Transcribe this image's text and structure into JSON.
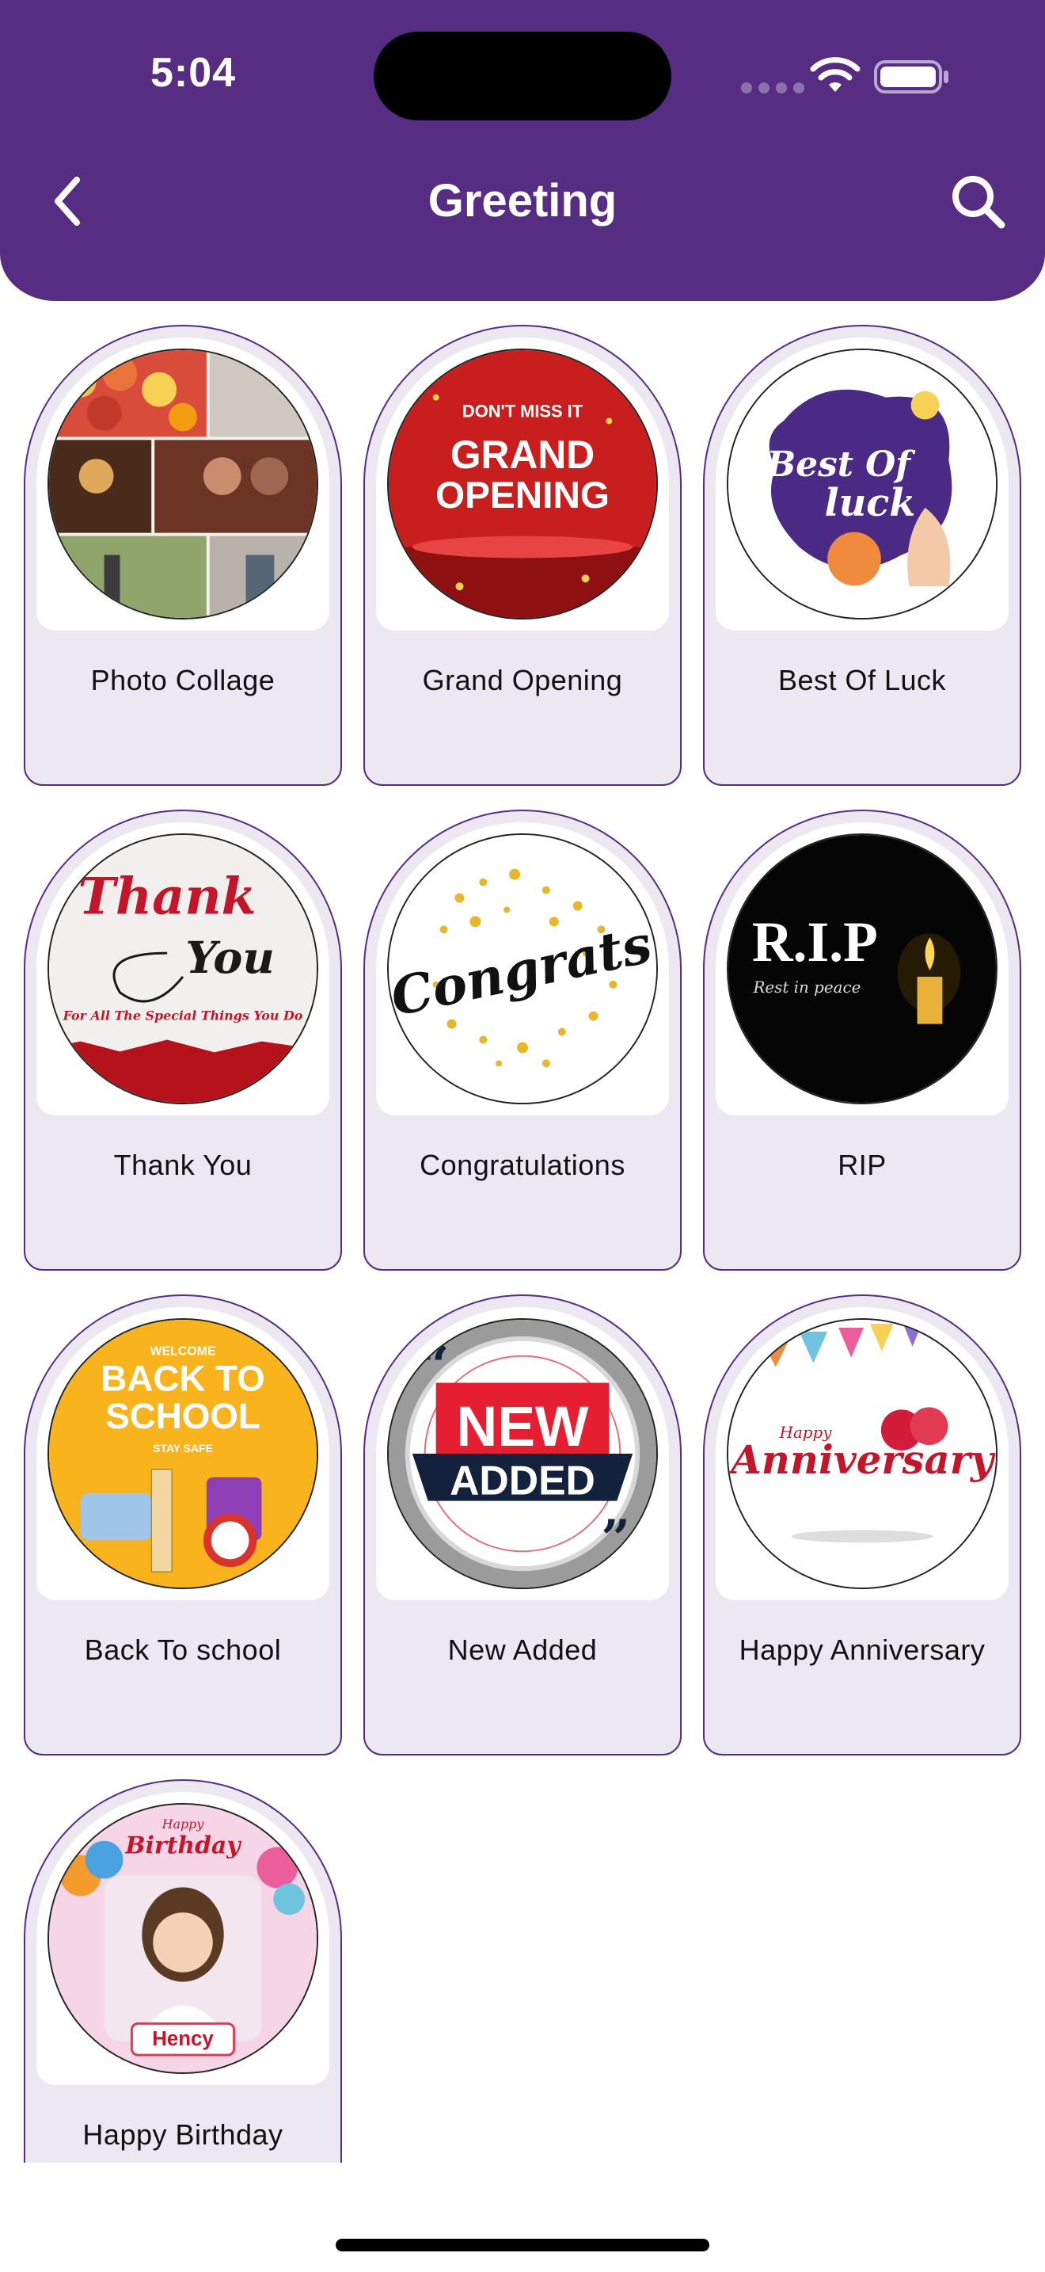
{
  "status_bar": {
    "time": "5:04"
  },
  "header": {
    "title": "Greeting"
  },
  "colors": {
    "header_bg": "#572c83",
    "card_bg": "#ebe8f2",
    "card_border": "#572c83"
  },
  "icons": {
    "back": "chevron-left-icon",
    "search": "search-icon",
    "wifi": "wifi-icon",
    "battery": "battery-icon"
  },
  "categories": [
    {
      "label": "Photo Collage"
    },
    {
      "label": "Grand Opening",
      "thumb_text": [
        "DON'T MISS IT",
        "GRAND",
        "OPENING"
      ]
    },
    {
      "label": "Best Of Luck",
      "thumb_text": [
        "Best Of",
        "luck"
      ]
    },
    {
      "label": "Thank You",
      "thumb_text": [
        "Thank",
        "You",
        "For All The Special Things You Do"
      ]
    },
    {
      "label": "Congratulations",
      "thumb_text": [
        "Congrats"
      ]
    },
    {
      "label": "RIP",
      "thumb_text": [
        "R.I.P",
        "Rest in peace"
      ]
    },
    {
      "label": "Back To school",
      "thumb_text": [
        "WELCOME",
        "BACK TO",
        "SCHOOL",
        "STAY SAFE"
      ]
    },
    {
      "label": "New Added",
      "thumb_text": [
        "NEW",
        "ADDED"
      ]
    },
    {
      "label": "Happy Anniversary",
      "thumb_text": [
        "Happy",
        "Anniversary"
      ]
    },
    {
      "label": "Happy Birthday",
      "thumb_text": [
        "Happy",
        "Birthday",
        "Hency"
      ]
    }
  ]
}
